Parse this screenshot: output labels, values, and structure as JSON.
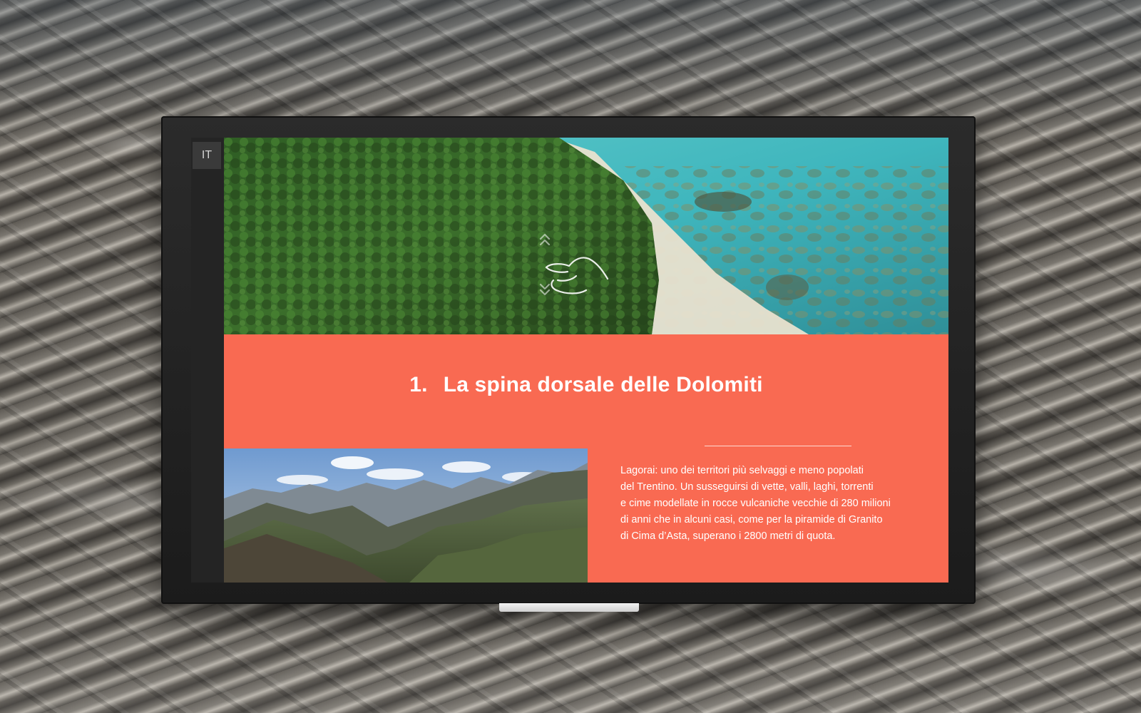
{
  "monitor": {
    "language_button": "IT"
  },
  "chapter": {
    "number": "1.",
    "title": "La spina dorsale delle Dolomiti",
    "body_lines": [
      "Lagorai: uno dei territori più selvaggi e meno popolati",
      "del Trentino. Un susseguirsi di vette, valli, laghi, torrenti",
      "e cime modellate in rocce vulcaniche vecchie di 280 milioni",
      "di anni che in alcuni casi, come per la piramide di Granito",
      "di Cima d’Asta, superano i 2800 metri di quota."
    ]
  },
  "colors": {
    "panel": "#f96a52",
    "sidebar": "#242424",
    "text": "#ffffff"
  },
  "icons": {
    "gesture": "swipe-up-hand-icon"
  }
}
